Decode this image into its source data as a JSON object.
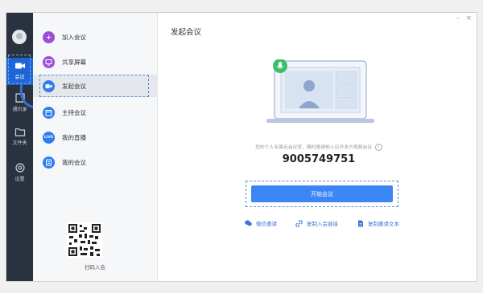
{
  "window": {
    "title": "发起会议",
    "minimize_glyph": "–",
    "close_glyph": "×"
  },
  "rail": {
    "items": [
      {
        "label": "会议",
        "icon": "video-camera-icon",
        "active": true
      },
      {
        "label": "通讯录",
        "icon": "contacts-icon",
        "active": false
      },
      {
        "label": "文件夹",
        "icon": "folder-icon",
        "active": false
      },
      {
        "label": "设置",
        "icon": "gear-icon",
        "active": false
      }
    ]
  },
  "menu": {
    "items": [
      {
        "label": "加入会议",
        "icon": "plus-icon",
        "color": "#9b4fd8"
      },
      {
        "label": "共享屏幕",
        "icon": "screen-share-icon",
        "color": "#9b4fd8"
      },
      {
        "label": "发起会议",
        "icon": "video-camera-icon",
        "color": "#2d7cf0",
        "selected": true
      },
      {
        "label": "主持会议",
        "icon": "calendar-icon",
        "color": "#2d7cf0"
      },
      {
        "label": "我的直播",
        "icon": "live-icon",
        "color": "#2d7cf0",
        "badge": "LIVE"
      },
      {
        "label": "我的会议",
        "icon": "meeting-list-icon",
        "color": "#2d7cf0"
      }
    ],
    "qr_label": "扫码入会"
  },
  "main": {
    "pmi_hint": "您的个人专属云会议室，随时邀请他人召开多方视频会议",
    "pmi_number": "9005749751",
    "start_button": "开始会议",
    "links": [
      {
        "label": "微信邀请",
        "icon": "wechat-icon"
      },
      {
        "label": "复制入会链接",
        "icon": "link-icon"
      },
      {
        "label": "复制邀请文本",
        "icon": "document-icon"
      }
    ]
  },
  "colors": {
    "rail_bg": "#2a3240",
    "accent": "#3b85f5",
    "highlight_dash": "#5b8ed8",
    "mic_green": "#3cbf6a"
  }
}
